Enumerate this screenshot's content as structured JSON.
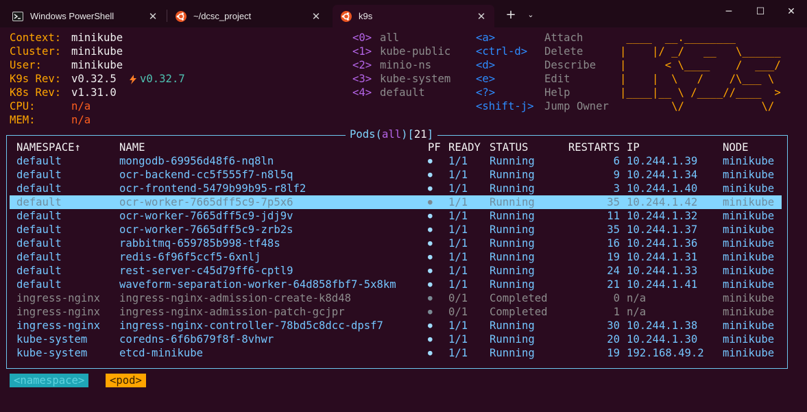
{
  "tabs": [
    {
      "label": "Windows PowerShell",
      "icon": "powershell-icon"
    },
    {
      "label": "~/dcsc_project",
      "icon": "ubuntu-icon"
    },
    {
      "label": "k9s",
      "icon": "ubuntu-icon"
    }
  ],
  "info": [
    {
      "key": "Context:",
      "value": "minikube"
    },
    {
      "key": "Cluster:",
      "value": "minikube"
    },
    {
      "key": "User:",
      "value": "minikube"
    },
    {
      "key": "K9s Rev:",
      "value": "v0.32.5",
      "extra": "v0.32.7"
    },
    {
      "key": "K8s Rev:",
      "value": "v1.31.0"
    },
    {
      "key": "CPU:",
      "value": "n/a"
    },
    {
      "key": "MEM:",
      "value": "n/a"
    }
  ],
  "namespaces": [
    {
      "key": "<0>",
      "name": "all"
    },
    {
      "key": "<1>",
      "name": "kube-public"
    },
    {
      "key": "<2>",
      "name": "minio-ns"
    },
    {
      "key": "<3>",
      "name": "kube-system"
    },
    {
      "key": "<4>",
      "name": "default"
    }
  ],
  "shortcuts": [
    {
      "key": "<a>",
      "action": "Attach"
    },
    {
      "key": "<ctrl-d>",
      "action": "Delete"
    },
    {
      "key": "<d>",
      "action": "Describe"
    },
    {
      "key": "<e>",
      "action": "Edit"
    },
    {
      "key": "<?>",
      "action": "Help"
    },
    {
      "key": "<shift-j>",
      "action": "Jump Owner"
    }
  ],
  "logo": [
    " ____  __.________       ",
    "|    |/ _/   __   \\______",
    "|      < \\____    /  ___/",
    "|    |  \\   /    /\\___ \\ ",
    "|____|__ \\ /____//____  >",
    "        \\/            \\/ "
  ],
  "panel": {
    "resource": "Pods",
    "ns": "all",
    "count": "21"
  },
  "columns": {
    "namespace": "NAMESPACE↑",
    "name": "NAME",
    "pf": "PF",
    "ready": "READY",
    "status": "STATUS",
    "restarts": "RESTARTS",
    "ip": "IP",
    "node": "NODE"
  },
  "pods": [
    {
      "namespace": "default",
      "name": "mongodb-69956d48f6-nq8ln",
      "pf": "●",
      "ready": "1/1",
      "status": "Running",
      "restarts": "6",
      "ip": "10.244.1.39",
      "node": "minikube"
    },
    {
      "namespace": "default",
      "name": "ocr-backend-cc5f555f7-n8l5q",
      "pf": "●",
      "ready": "1/1",
      "status": "Running",
      "restarts": "9",
      "ip": "10.244.1.34",
      "node": "minikube"
    },
    {
      "namespace": "default",
      "name": "ocr-frontend-5479b99b95-r8lf2",
      "pf": "●",
      "ready": "1/1",
      "status": "Running",
      "restarts": "3",
      "ip": "10.244.1.40",
      "node": "minikube"
    },
    {
      "namespace": "default",
      "name": "ocr-worker-7665dff5c9-7p5x6",
      "pf": "●",
      "ready": "1/1",
      "status": "Running",
      "restarts": "35",
      "ip": "10.244.1.42",
      "node": "minikube"
    },
    {
      "namespace": "default",
      "name": "ocr-worker-7665dff5c9-jdj9v",
      "pf": "●",
      "ready": "1/1",
      "status": "Running",
      "restarts": "11",
      "ip": "10.244.1.32",
      "node": "minikube"
    },
    {
      "namespace": "default",
      "name": "ocr-worker-7665dff5c9-zrb2s",
      "pf": "●",
      "ready": "1/1",
      "status": "Running",
      "restarts": "35",
      "ip": "10.244.1.37",
      "node": "minikube"
    },
    {
      "namespace": "default",
      "name": "rabbitmq-659785b998-tf48s",
      "pf": "●",
      "ready": "1/1",
      "status": "Running",
      "restarts": "16",
      "ip": "10.244.1.36",
      "node": "minikube"
    },
    {
      "namespace": "default",
      "name": "redis-6f96f5ccf5-6xnlj",
      "pf": "●",
      "ready": "1/1",
      "status": "Running",
      "restarts": "19",
      "ip": "10.244.1.31",
      "node": "minikube"
    },
    {
      "namespace": "default",
      "name": "rest-server-c45d79ff6-cptl9",
      "pf": "●",
      "ready": "1/1",
      "status": "Running",
      "restarts": "24",
      "ip": "10.244.1.33",
      "node": "minikube"
    },
    {
      "namespace": "default",
      "name": "waveform-separation-worker-64d858fbf7-5x8km",
      "pf": "●",
      "ready": "1/1",
      "status": "Running",
      "restarts": "21",
      "ip": "10.244.1.41",
      "node": "minikube"
    },
    {
      "namespace": "ingress-nginx",
      "name": "ingress-nginx-admission-create-k8d48",
      "pf": "●",
      "ready": "0/1",
      "status": "Completed",
      "restarts": "0",
      "ip": "n/a",
      "node": "minikube"
    },
    {
      "namespace": "ingress-nginx",
      "name": "ingress-nginx-admission-patch-gcjpr",
      "pf": "●",
      "ready": "0/1",
      "status": "Completed",
      "restarts": "1",
      "ip": "n/a",
      "node": "minikube"
    },
    {
      "namespace": "ingress-nginx",
      "name": "ingress-nginx-controller-78bd5c8dcc-dpsf7",
      "pf": "●",
      "ready": "1/1",
      "status": "Running",
      "restarts": "30",
      "ip": "10.244.1.38",
      "node": "minikube"
    },
    {
      "namespace": "kube-system",
      "name": "coredns-6f6b679f8f-8vhwr",
      "pf": "●",
      "ready": "1/1",
      "status": "Running",
      "restarts": "20",
      "ip": "10.244.1.30",
      "node": "minikube"
    },
    {
      "namespace": "kube-system",
      "name": "etcd-minikube",
      "pf": "●",
      "ready": "1/1",
      "status": "Running",
      "restarts": "19",
      "ip": "192.168.49.2",
      "node": "minikube"
    }
  ],
  "selected_row": 3,
  "breadcrumbs": [
    "<namespace>",
    "<pod>"
  ]
}
